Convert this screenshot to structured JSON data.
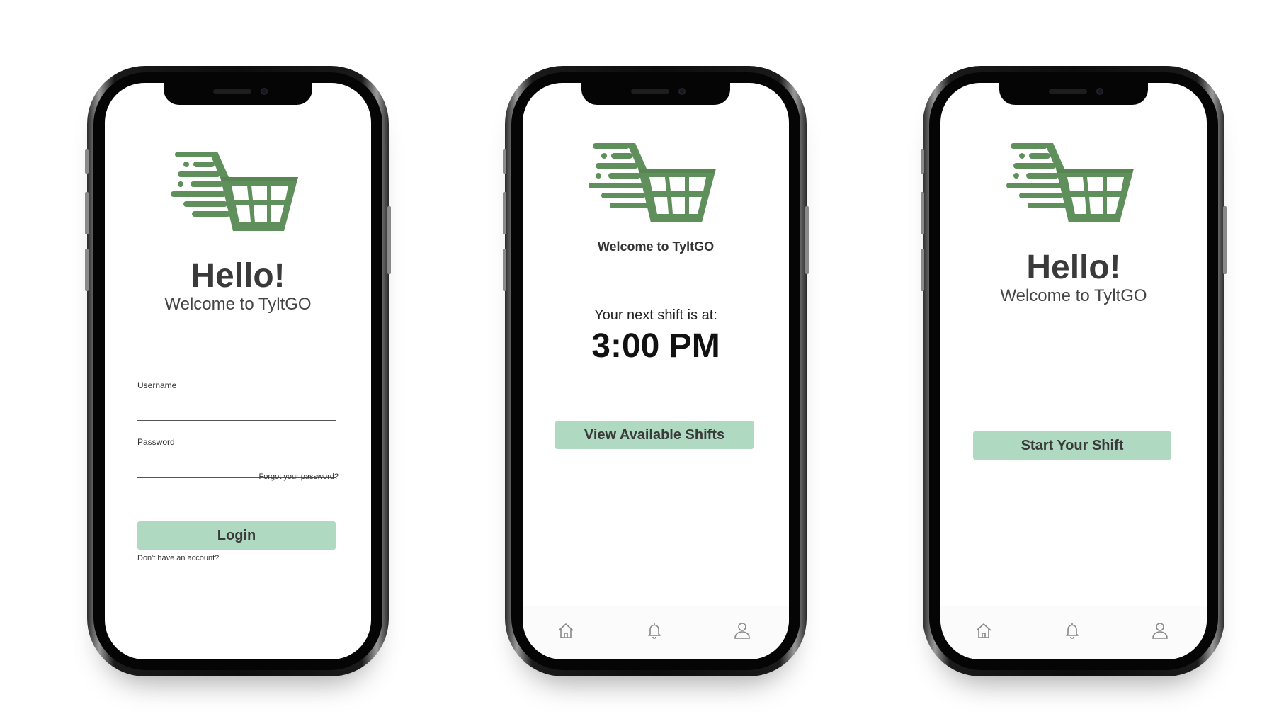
{
  "brand": {
    "accent": "#afd9c1",
    "logo_green": "#5f8f5a"
  },
  "login_screen": {
    "greeting": "Hello!",
    "welcome": "Welcome to TyltGO",
    "username_label": "Username",
    "username_value": "",
    "password_label": "Password",
    "password_value": "",
    "forgot_password": "Forgot your password?",
    "login_button": "Login",
    "signup_prompt": "Don't have an account?"
  },
  "shifts_screen": {
    "welcome": "Welcome to TyltGO",
    "next_shift_label": "Your next shift is at:",
    "next_shift_time": "3:00 PM",
    "view_shifts_button": "View Available Shifts",
    "tabs": [
      {
        "icon": "home-icon"
      },
      {
        "icon": "bell-icon"
      },
      {
        "icon": "user-icon"
      }
    ]
  },
  "start_screen": {
    "greeting": "Hello!",
    "welcome": "Welcome to TyltGO",
    "start_button": "Start Your Shift",
    "tabs": [
      {
        "icon": "home-icon"
      },
      {
        "icon": "bell-icon"
      },
      {
        "icon": "user-icon"
      }
    ]
  }
}
